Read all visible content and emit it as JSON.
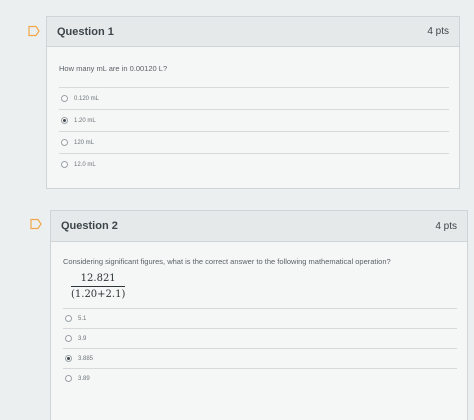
{
  "question1": {
    "title": "Question 1",
    "points": "4 pts",
    "text": "How many mL are in 0.00120 L?",
    "answers": [
      {
        "label": "0.120 mL",
        "selected": false
      },
      {
        "label": "1.20 mL",
        "selected": true
      },
      {
        "label": "120 mL",
        "selected": false
      },
      {
        "label": "12.0 mL",
        "selected": false
      }
    ]
  },
  "question2": {
    "title": "Question 2",
    "points": "4 pts",
    "text": "Considering significant figures, what is the correct answer to the following mathematical operation?",
    "fraction": {
      "numerator": "12.821",
      "denominator": "(1.20+2.1)"
    },
    "answers": [
      {
        "label": "5.1",
        "selected": false
      },
      {
        "label": "3.9",
        "selected": false
      },
      {
        "label": "3.885",
        "selected": true
      },
      {
        "label": "3.89",
        "selected": false
      }
    ]
  },
  "colors": {
    "flag": "#f0a64a",
    "card_header": "#e6e9ea",
    "card_body": "#f5f6f6",
    "background": "#eceff0"
  }
}
